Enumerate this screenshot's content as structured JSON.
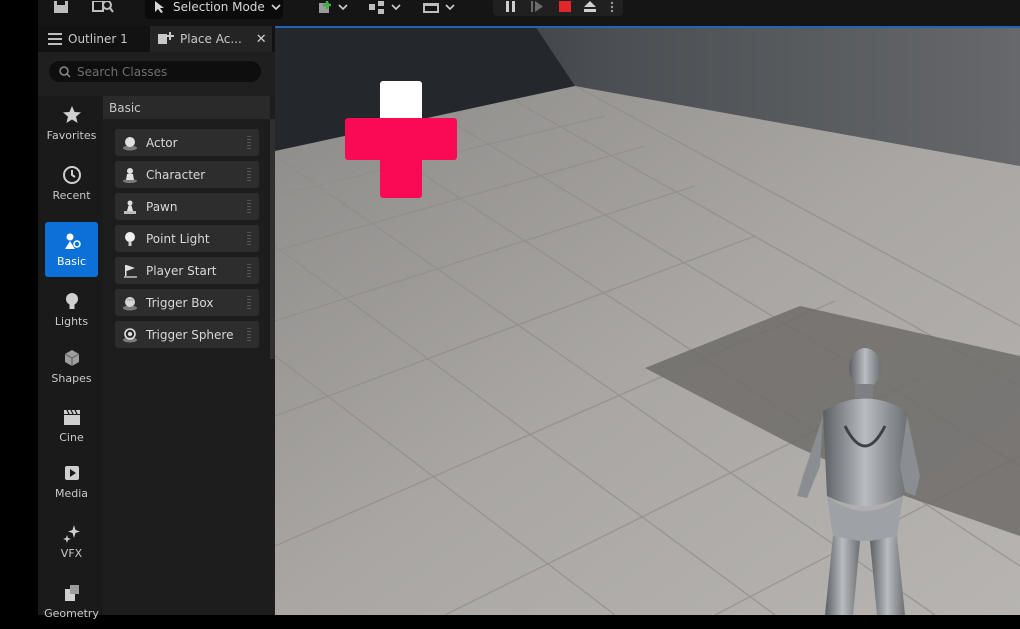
{
  "toolbar": {
    "selection_mode_label": "Selection Mode",
    "icons": [
      "save-icon",
      "browse-icon",
      "chevron-down-icon",
      "add-content-icon",
      "blueprint-icon",
      "cinematics-icon",
      "pause-icon",
      "skip-frame-icon",
      "stop-icon",
      "eject-icon",
      "more-options-icon"
    ]
  },
  "tabs": [
    {
      "label": "Outliner 1",
      "icon": "outliner-icon",
      "active": false
    },
    {
      "label": "Place Ac...",
      "icon": "place-actors-icon",
      "active": true
    }
  ],
  "search": {
    "placeholder": "Search Classes",
    "value": ""
  },
  "categories": [
    {
      "label": "Favorites",
      "icon": "star-icon"
    },
    {
      "label": "Recent",
      "icon": "clock-icon"
    },
    {
      "label": "Basic",
      "icon": "basic-shapes-icon",
      "active": true
    },
    {
      "label": "Lights",
      "icon": "lightbulb-icon"
    },
    {
      "label": "Shapes",
      "icon": "cube-icon"
    },
    {
      "label": "Cine",
      "icon": "clapperboard-icon"
    },
    {
      "label": "Media",
      "icon": "media-play-icon"
    },
    {
      "label": "VFX",
      "icon": "sparkles-icon"
    },
    {
      "label": "Geometry",
      "icon": "geometry-icon"
    }
  ],
  "list": {
    "header": "Basic",
    "items": [
      {
        "label": "Actor",
        "icon": "actor-sphere-icon"
      },
      {
        "label": "Character",
        "icon": "character-icon"
      },
      {
        "label": "Pawn",
        "icon": "pawn-icon"
      },
      {
        "label": "Point Light",
        "icon": "point-light-icon"
      },
      {
        "label": "Player Start",
        "icon": "player-start-flag-icon"
      },
      {
        "label": "Trigger Box",
        "icon": "trigger-box-icon"
      },
      {
        "label": "Trigger Sphere",
        "icon": "trigger-sphere-icon"
      }
    ]
  },
  "colors": {
    "accent_blue": "#0b70d8",
    "health_cross": "#fa0a55",
    "stop_red": "#e0282c"
  }
}
